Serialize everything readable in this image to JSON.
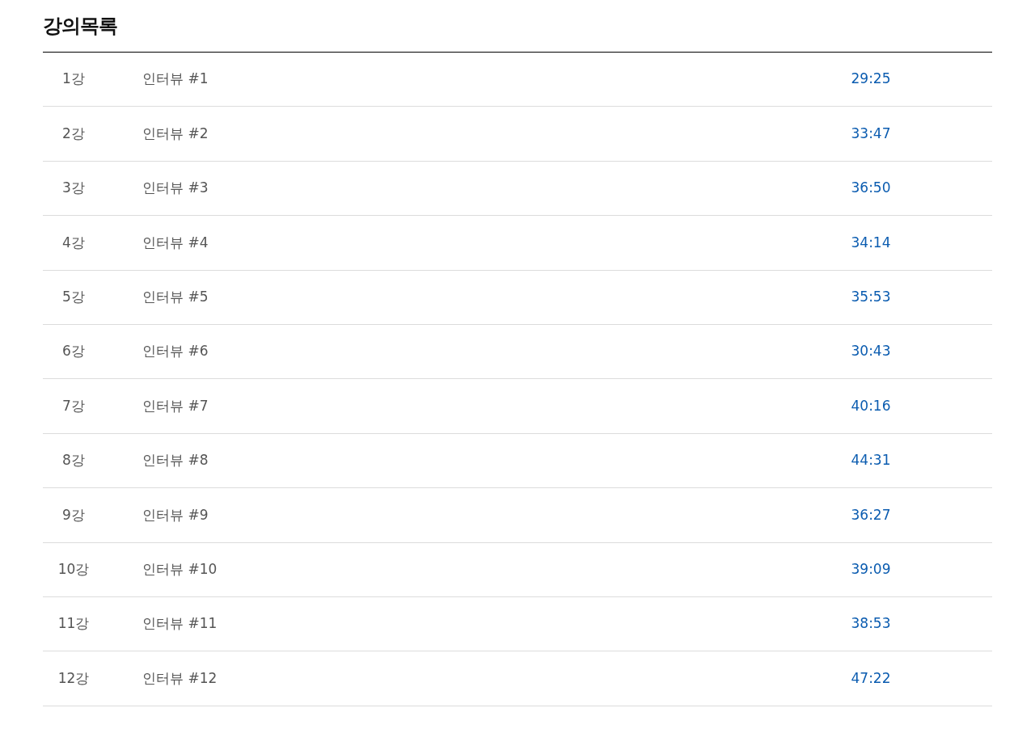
{
  "title": "강의목록",
  "lectures": [
    {
      "number": "1강",
      "name": "인터뷰 #1",
      "duration": "29:25"
    },
    {
      "number": "2강",
      "name": "인터뷰 #2",
      "duration": "33:47"
    },
    {
      "number": "3강",
      "name": "인터뷰 #3",
      "duration": "36:50"
    },
    {
      "number": "4강",
      "name": "인터뷰 #4",
      "duration": "34:14"
    },
    {
      "number": "5강",
      "name": "인터뷰 #5",
      "duration": "35:53"
    },
    {
      "number": "6강",
      "name": "인터뷰 #6",
      "duration": "30:43"
    },
    {
      "number": "7강",
      "name": "인터뷰 #7",
      "duration": "40:16"
    },
    {
      "number": "8강",
      "name": "인터뷰 #8",
      "duration": "44:31"
    },
    {
      "number": "9강",
      "name": "인터뷰 #9",
      "duration": "36:27"
    },
    {
      "number": "10강",
      "name": "인터뷰 #10",
      "duration": "39:09"
    },
    {
      "number": "11강",
      "name": "인터뷰 #11",
      "duration": "38:53"
    },
    {
      "number": "12강",
      "name": "인터뷰 #12",
      "duration": "47:22"
    }
  ]
}
